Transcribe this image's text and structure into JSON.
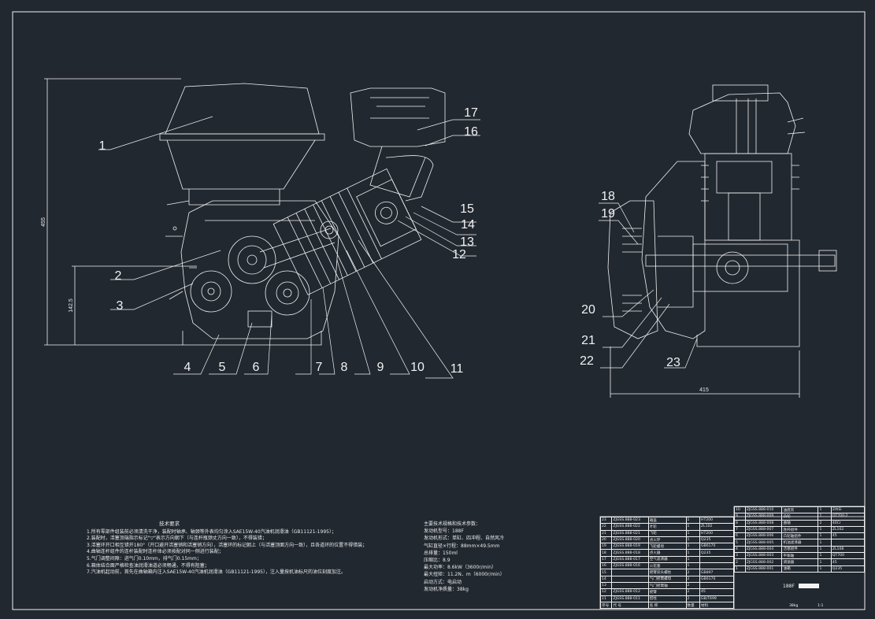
{
  "drawing": {
    "part_numbers": [
      "1",
      "2",
      "3",
      "4",
      "5",
      "6",
      "7",
      "8",
      "9",
      "10",
      "11",
      "12",
      "13",
      "14",
      "15",
      "16",
      "17",
      "18",
      "19",
      "20",
      "21",
      "22",
      "23"
    ],
    "dimensions": {
      "total_height": "455",
      "crank_height": "142.5",
      "width": "415"
    }
  },
  "tech_requirements": {
    "title": "技术要求",
    "items": [
      "1.所有零部件组装前必须清洗干净，装配时轴承、轴颈等外表均匀涂入SAE15W-40汽油机润滑油（GB11121-1995）；",
      "2.装配时，活塞顶端指示标记\"▽\"表示方向朝下（与连杆瓶颈丈方向一致），不得装错；",
      "3.活塞环开口相互错开180°（开口避开活塞销和活塞销方向），活塞环的标记朝上（与活塞顶面方向一致），且各道环的位置不得错装；",
      "4.曲轴连杆组件的连杆装配时连杆体必须按配对同一侧进行装配；",
      "5.气门调整间隙：进气门0.10mm，排气门0.15mm；",
      "6.箱体结合面严格检查油润滑油道必须畅通，不得有阻塞；",
      "7.汽油机起动前，首先在曲轴箱内注入SAE15W-40汽油机润滑油（GB11121-1995），注入量按机油标尺的油位刻度加注。"
    ]
  },
  "specs": {
    "title": "主要技术规格和技术参数：",
    "items": [
      "发动机型号：188F",
      "发动机形式：单缸、四冲程、自然风冷",
      "气缸直径×行程：88mm×49.5mm",
      "总排量：150ml",
      "压缩比：8.9",
      "最大功率：8.6kW（3600r/min）",
      "最大扭矩：11.2N．m（6000r/min）",
      "启动方式：电启动",
      "发动机净质量：38kg"
    ]
  },
  "parts_table": {
    "rows": [
      {
        "no": "23",
        "code": "ZJGSS.888-023",
        "name": "箱盖",
        "qty": "1",
        "mat": "HT200"
      },
      {
        "no": "22",
        "code": "ZJGSS.888-022",
        "name": "叶轮",
        "qty": "1",
        "mat": "ZL102"
      },
      {
        "no": "21",
        "code": "ZJGSS.888-021",
        "name": "飞轮",
        "qty": "1",
        "mat": "HT200"
      },
      {
        "no": "20",
        "code": "ZJGSS.888-020",
        "name": "点火环",
        "qty": "1",
        "mat": "Q235"
      },
      {
        "no": "19",
        "code": "ZJGSS.888-019",
        "name": "飞轮螺母",
        "qty": "1",
        "mat": "GB6170"
      },
      {
        "no": "18",
        "code": "ZJGSS.888-018",
        "name": "点火器",
        "qty": "1",
        "mat": "Q235"
      },
      {
        "no": "17",
        "code": "ZJGSS.888-017",
        "name": "空气滤清器",
        "qty": "1",
        "mat": ""
      },
      {
        "no": "16",
        "code": "ZJGSS.888-016",
        "name": "火花塞",
        "qty": "1",
        "mat": ""
      },
      {
        "no": "15",
        "code": "",
        "name": "摇臂双头螺柱",
        "qty": "2",
        "mat": "GB897"
      },
      {
        "no": "14",
        "code": "",
        "name": "气门摇臂螺母",
        "qty": "2",
        "mat": "GB6170"
      },
      {
        "no": "13",
        "code": "",
        "name": "气门摇臂轴",
        "qty": "2",
        "mat": ""
      },
      {
        "no": "12",
        "code": "ZJGSS.888-012",
        "name": "摇臂",
        "qty": "2",
        "mat": "45"
      },
      {
        "no": "11",
        "code": "ZJGSS.888-011",
        "name": "挺柱",
        "qty": "2",
        "mat": "GB/T699"
      }
    ],
    "rows_right": [
      {
        "no": "10",
        "code": "ZJGSS.888-010",
        "name": "油底壳",
        "qty": "1",
        "mat": "ZAlSi"
      },
      {
        "no": "9",
        "code": "ZJGSS.888-009",
        "name": "凸轮",
        "qty": "1",
        "mat": "QT700-2"
      },
      {
        "no": "8",
        "code": "ZJGSS.888-008",
        "name": "曲轴",
        "qty": "2",
        "mat": "40Cr"
      },
      {
        "no": "7",
        "code": "ZJGSS.888-007",
        "name": "连杆组件",
        "qty": "1",
        "mat": "ZL102"
      },
      {
        "no": "6",
        "code": "ZJGSS.888-006",
        "name": "凸轮轴组件",
        "qty": "1",
        "mat": "45"
      },
      {
        "no": "5",
        "code": "ZJGSS.888-005",
        "name": "机油滤清器",
        "qty": "1",
        "mat": ""
      },
      {
        "no": "4",
        "code": "ZJGSS.888-004",
        "name": "活塞组件",
        "qty": "1",
        "mat": "ZL108"
      },
      {
        "no": "3",
        "code": "ZJGSS.888-003",
        "name": "平衡轴",
        "qty": "1",
        "mat": "QT700"
      },
      {
        "no": "2",
        "code": "ZJGSS.888-002",
        "name": "调速器",
        "qty": "1",
        "mat": "45"
      },
      {
        "no": "1",
        "code": "ZJGSS.888-001",
        "name": "油箱",
        "qty": "1",
        "mat": "Q235"
      }
    ],
    "header": {
      "no": "序号",
      "code": "代 号",
      "name": "名 称",
      "qty": "数量",
      "mat": "材料"
    },
    "title_block": {
      "name": "188F",
      "scale": "1:1",
      "weight": "38kg"
    }
  },
  "colors": {
    "background": "#212830",
    "lines": "#f2f2f2"
  }
}
